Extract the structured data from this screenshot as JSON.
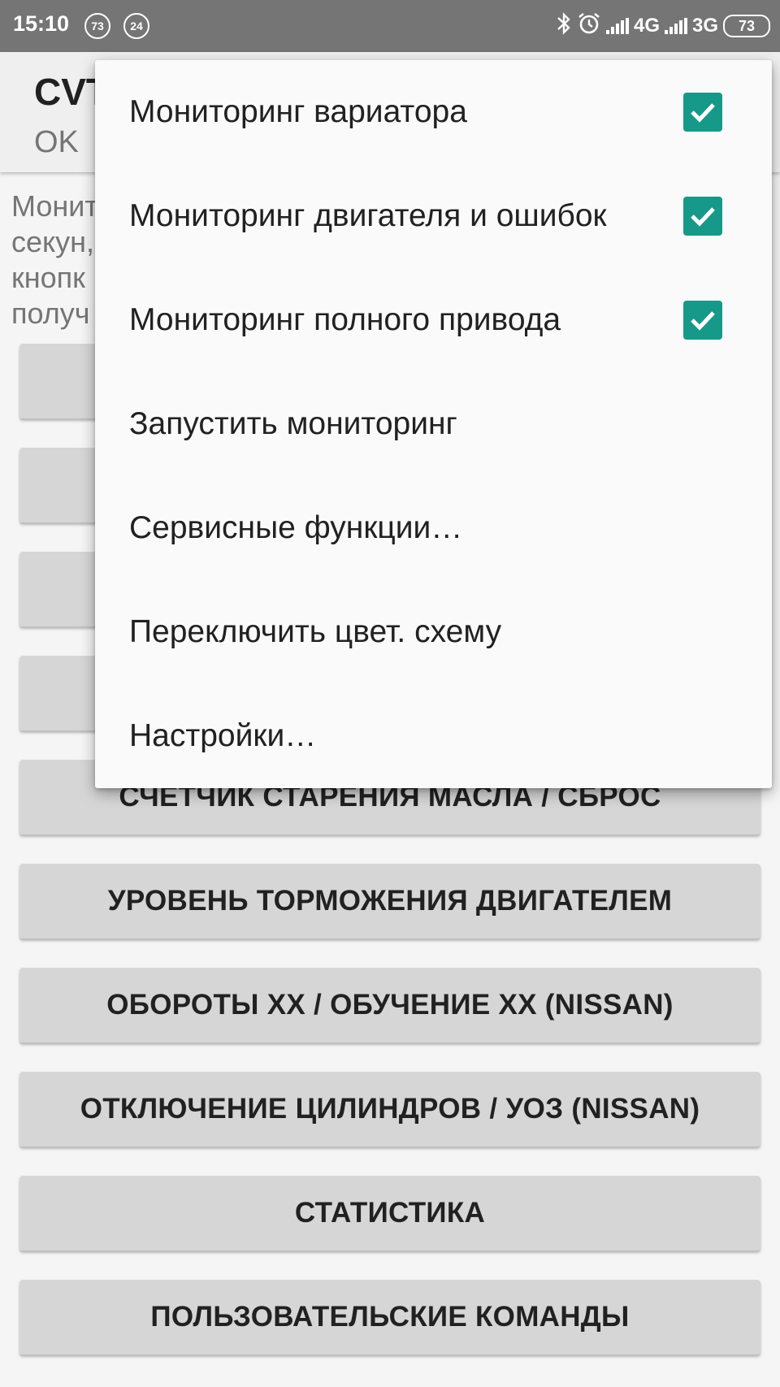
{
  "status_bar": {
    "time": "15:10",
    "badge1": "73",
    "badge2": "24",
    "network1": "4G",
    "network2": "3G",
    "battery": "73",
    "icons": [
      "bluetooth-icon",
      "alarm-icon",
      "signal-icon",
      "signal-icon",
      "battery-icon"
    ]
  },
  "app_bar": {
    "title": "CVT",
    "subtitle": "OK"
  },
  "description": "Монит\nсекун,\nкнопк\nполуч",
  "buttons": [
    "СЧЕТЧИК СТАРЕНИЯ МАСЛА / СБРОС",
    "УРОВЕНЬ ТОРМОЖЕНИЯ ДВИГАТЕЛЕМ",
    "ОБОРОТЫ ХХ / ОБУЧЕНИЕ ХХ (NISSAN)",
    "ОТКЛЮЧЕНИЕ ЦИЛИНДРОВ / УОЗ (NISSAN)",
    "СТАТИСТИКА",
    "ПОЛЬЗОВАТЕЛЬСКИЕ КОМАНДЫ"
  ],
  "menu": {
    "items": [
      {
        "label": "Мониторинг вариатора",
        "checked": true
      },
      {
        "label": "Мониторинг двигателя и ошибок",
        "checked": true
      },
      {
        "label": "Мониторинг полного привода",
        "checked": true
      },
      {
        "label": "Запустить мониторинг"
      },
      {
        "label": "Сервисные функции…"
      },
      {
        "label": "Переключить цвет. схему"
      },
      {
        "label": "Настройки…"
      }
    ]
  },
  "colors": {
    "accent": "#17998a",
    "status_bar": "#757575",
    "button": "#d6d6d6"
  }
}
